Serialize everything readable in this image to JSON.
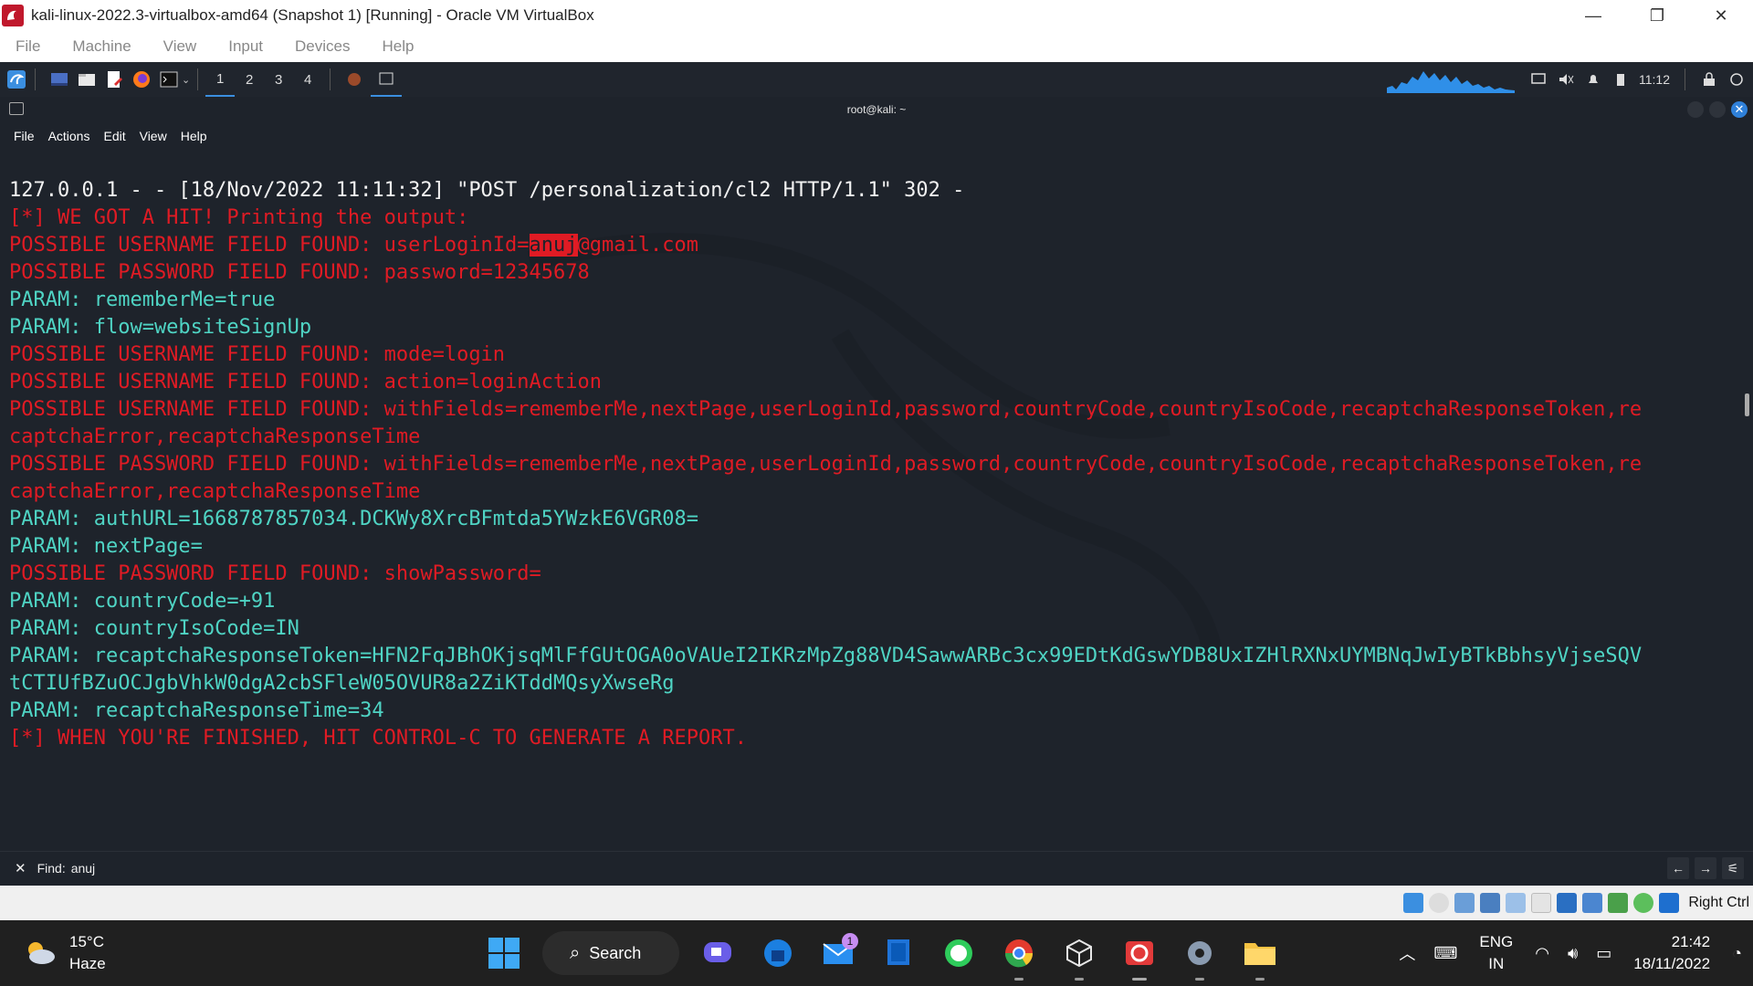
{
  "window": {
    "title": "kali-linux-2022.3-virtualbox-amd64 (Snapshot 1) [Running] - Oracle VM VirtualBox",
    "controls": {
      "minimize": "—",
      "restore": "❐",
      "close": "✕"
    }
  },
  "vb_menu": [
    "File",
    "Machine",
    "View",
    "Input",
    "Devices",
    "Help"
  ],
  "kali_panel": {
    "workspaces": [
      "1",
      "2",
      "3",
      "4"
    ],
    "clock": "11:12"
  },
  "terminal": {
    "title": "root@kali: ~",
    "menu": [
      "File",
      "Actions",
      "Edit",
      "View",
      "Help"
    ],
    "lines": [
      {
        "color": "white",
        "text": "127.0.0.1 - - [18/Nov/2022 11:11:32] \"POST /personalization/cl2 HTTP/1.1\" 302 -"
      },
      {
        "color": "red",
        "text": "[*] WE GOT A HIT! Printing the output:"
      },
      {
        "color": "red",
        "pre": "POSSIBLE USERNAME FIELD FOUND: userLoginId=",
        "hl": "anuj",
        "post": "@gmail.com"
      },
      {
        "color": "red",
        "text": "POSSIBLE PASSWORD FIELD FOUND: password=12345678"
      },
      {
        "color": "teal",
        "text": "PARAM: rememberMe=true"
      },
      {
        "color": "teal",
        "text": "PARAM: flow=websiteSignUp"
      },
      {
        "color": "red",
        "text": "POSSIBLE USERNAME FIELD FOUND: mode=login"
      },
      {
        "color": "red",
        "text": "POSSIBLE USERNAME FIELD FOUND: action=loginAction"
      },
      {
        "color": "red",
        "text": "POSSIBLE USERNAME FIELD FOUND: withFields=rememberMe,nextPage,userLoginId,password,countryCode,countryIsoCode,recaptchaResponseToken,re"
      },
      {
        "color": "red",
        "text": "captchaError,recaptchaResponseTime"
      },
      {
        "color": "red",
        "text": "POSSIBLE PASSWORD FIELD FOUND: withFields=rememberMe,nextPage,userLoginId,password,countryCode,countryIsoCode,recaptchaResponseToken,re"
      },
      {
        "color": "red",
        "text": "captchaError,recaptchaResponseTime"
      },
      {
        "color": "teal",
        "text": "PARAM: authURL=1668787857034.DCKWy8XrcBFmtda5YWzkE6VGR08="
      },
      {
        "color": "teal",
        "text": "PARAM: nextPage="
      },
      {
        "color": "red",
        "text": "POSSIBLE PASSWORD FIELD FOUND: showPassword="
      },
      {
        "color": "teal",
        "text": "PARAM: countryCode=+91"
      },
      {
        "color": "teal",
        "text": "PARAM: countryIsoCode=IN"
      },
      {
        "color": "teal",
        "text": "PARAM: recaptchaResponseToken=HFN2FqJBhOKjsqMlFfGUtOGA0oVAUeI2IKRzMpZg88VD4SawwARBc3cx99EDtKdGswYDB8UxIZHlRXNxUYMBNqJwIyBTkBbhsyVjseSQV"
      },
      {
        "color": "teal",
        "text": "tCTIUfBZuOCJgbVhkW0dgA2cbSFleW05OVUR8a2ZiKTddMQsyXwseRg"
      },
      {
        "color": "teal",
        "text": "PARAM: recaptchaResponseTime=34"
      },
      {
        "color": "red",
        "text": "[*] WHEN YOU'RE FINISHED, HIT CONTROL-C TO GENERATE A REPORT."
      }
    ],
    "find": {
      "label": "Find:",
      "value": "anuj",
      "close": "✕"
    }
  },
  "vb_status": {
    "host_key": "Right Ctrl"
  },
  "taskbar": {
    "weather": {
      "temp": "15°C",
      "condition": "Haze"
    },
    "search_label": "Search",
    "mail_badge": "1",
    "lang": {
      "line1": "ENG",
      "line2": "IN"
    },
    "clock": {
      "time": "21:42",
      "date": "18/11/2022"
    }
  },
  "colors": {
    "red": "#e01b24",
    "teal": "#4fd4c4",
    "white": "#f2f2f2",
    "terminal_bg": "#1e232b",
    "taskbar_bg": "#202020"
  }
}
